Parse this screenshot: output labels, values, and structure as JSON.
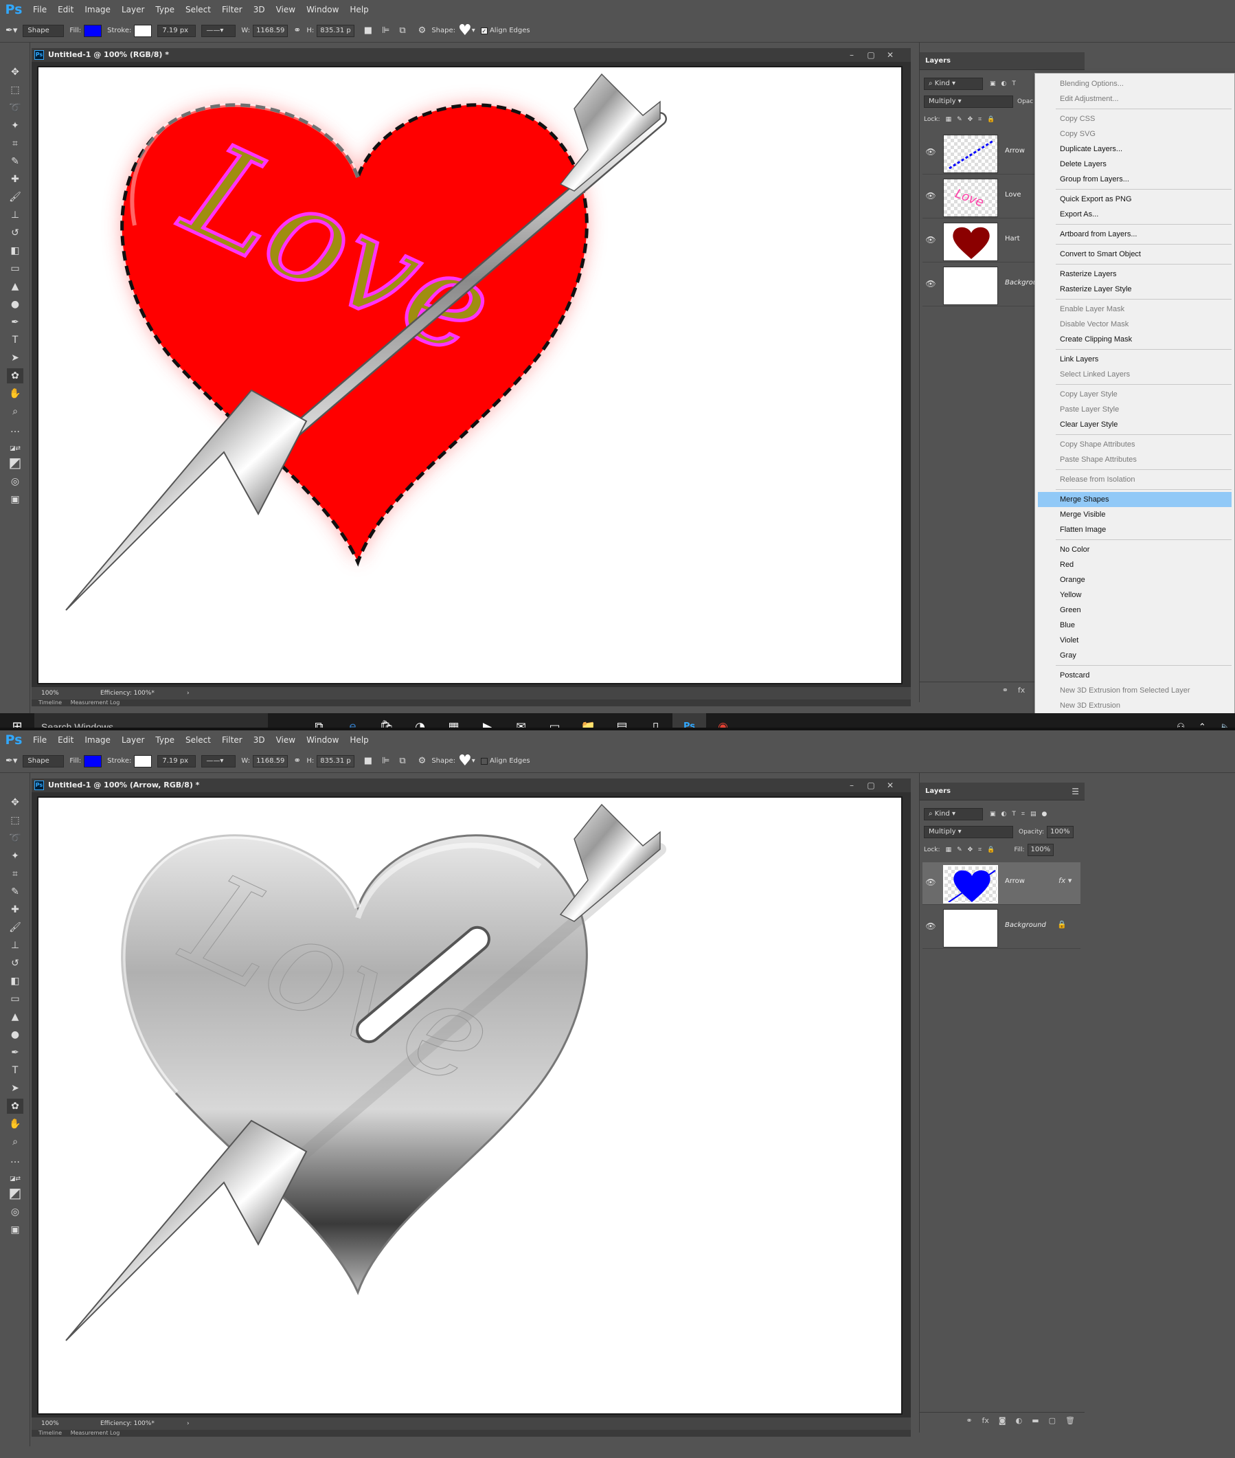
{
  "menu": [
    "File",
    "Edit",
    "Image",
    "Layer",
    "Type",
    "Select",
    "Filter",
    "3D",
    "View",
    "Window",
    "Help"
  ],
  "app_logo": "Ps",
  "options": {
    "shape_mode": "Shape",
    "fill_label": "Fill:",
    "stroke_label": "Stroke:",
    "stroke_width": "7.19 px",
    "w_label": "W:",
    "w_value": "1168.59",
    "h_label": "H:",
    "h_value": "835.31 p",
    "shape_label": "Shape:",
    "align_edges": "Align Edges",
    "fill_color": "#0000ff"
  },
  "screen1": {
    "doc_title": "Untitled-1 @ 100% (RGB/8) *",
    "zoom": "100%",
    "efficiency": "Efficiency: 100%*",
    "timeline_tabs": [
      "Timeline",
      "Measurement Log"
    ],
    "layers_title": "Layers",
    "kind": "Kind",
    "blend": "Multiply",
    "opacity_label": "Opac",
    "lock_label": "Lock:",
    "layers": [
      {
        "name": "Arrow"
      },
      {
        "name": "Love"
      },
      {
        "name": "Hart"
      },
      {
        "name": "Background"
      }
    ],
    "context_menu": {
      "groups": [
        [
          {
            "label": "Blending Options...",
            "enabled": false
          },
          {
            "label": "Edit Adjustment...",
            "enabled": false
          }
        ],
        [
          {
            "label": "Copy CSS",
            "enabled": false
          },
          {
            "label": "Copy SVG",
            "enabled": false
          },
          {
            "label": "Duplicate Layers...",
            "enabled": true
          },
          {
            "label": "Delete Layers",
            "enabled": true
          },
          {
            "label": "Group from Layers...",
            "enabled": true
          }
        ],
        [
          {
            "label": "Quick Export as PNG",
            "enabled": true
          },
          {
            "label": "Export As...",
            "enabled": true
          }
        ],
        [
          {
            "label": "Artboard from Layers...",
            "enabled": true
          }
        ],
        [
          {
            "label": "Convert to Smart Object",
            "enabled": true
          }
        ],
        [
          {
            "label": "Rasterize Layers",
            "enabled": true
          },
          {
            "label": "Rasterize Layer Style",
            "enabled": true
          }
        ],
        [
          {
            "label": "Enable Layer Mask",
            "enabled": false
          },
          {
            "label": "Disable Vector Mask",
            "enabled": false
          },
          {
            "label": "Create Clipping Mask",
            "enabled": true
          }
        ],
        [
          {
            "label": "Link Layers",
            "enabled": true
          },
          {
            "label": "Select Linked Layers",
            "enabled": false
          }
        ],
        [
          {
            "label": "Copy Layer Style",
            "enabled": false
          },
          {
            "label": "Paste Layer Style",
            "enabled": false
          },
          {
            "label": "Clear Layer Style",
            "enabled": true
          }
        ],
        [
          {
            "label": "Copy Shape Attributes",
            "enabled": false
          },
          {
            "label": "Paste Shape Attributes",
            "enabled": false
          }
        ],
        [
          {
            "label": "Release from Isolation",
            "enabled": false
          }
        ],
        [
          {
            "label": "Merge Shapes",
            "enabled": true,
            "highlighted": true
          },
          {
            "label": "Merge Visible",
            "enabled": true
          },
          {
            "label": "Flatten Image",
            "enabled": true
          }
        ],
        [
          {
            "label": "No Color",
            "enabled": true
          },
          {
            "label": "Red",
            "enabled": true
          },
          {
            "label": "Orange",
            "enabled": true
          },
          {
            "label": "Yellow",
            "enabled": true
          },
          {
            "label": "Green",
            "enabled": true
          },
          {
            "label": "Blue",
            "enabled": true
          },
          {
            "label": "Violet",
            "enabled": true
          },
          {
            "label": "Gray",
            "enabled": true
          }
        ],
        [
          {
            "label": "Postcard",
            "enabled": true
          },
          {
            "label": "New 3D Extrusion from Selected Layer",
            "enabled": false
          },
          {
            "label": "New 3D Extrusion",
            "enabled": false
          }
        ]
      ]
    },
    "canvas_text": "Love"
  },
  "taskbar": {
    "search": "Search Windows",
    "active_app": "Ps"
  },
  "screen2": {
    "doc_title": "Untitled-1 @ 100% (Arrow, RGB/8) *",
    "zoom": "100%",
    "efficiency": "Efficiency: 100%*",
    "timeline_tabs": [
      "Timeline",
      "Measurement Log"
    ],
    "layers_title": "Layers",
    "kind": "Kind",
    "blend": "Multiply",
    "opacity_label": "Opacity:",
    "opacity": "100%",
    "lock_label": "Lock:",
    "fill_label": "Fill:",
    "fill": "100%",
    "layers": [
      {
        "name": "Arrow"
      },
      {
        "name": "Background"
      }
    ],
    "canvas_text": "Love"
  },
  "colors": {
    "heart_red": "#ff0000",
    "love_gold": "#a08d10",
    "love_outline": "#ff33ff",
    "menu_highlight": "#91c9f7",
    "ps_blue": "#31a8ff"
  }
}
